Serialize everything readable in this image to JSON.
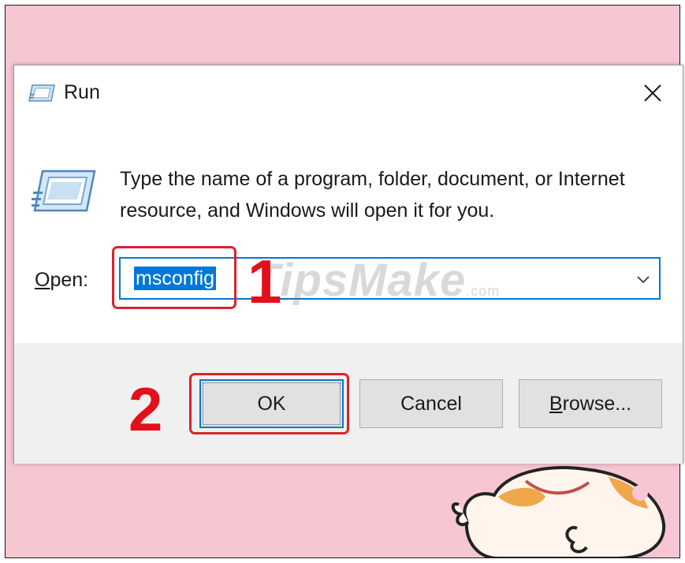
{
  "dialog": {
    "title": "Run",
    "description": "Type the name of a program, folder, document, or Internet resource, and Windows will open it for you.",
    "open_label_accel": "O",
    "open_label_rest": "pen:",
    "open_value": "msconfig",
    "buttons": {
      "ok": "OK",
      "cancel": "Cancel",
      "browse_accel": "B",
      "browse_rest": "rowse..."
    }
  },
  "annotations": {
    "step1": "1",
    "step2": "2",
    "watermark": "TipsMake",
    "watermark_suffix": ".com"
  },
  "icons": {
    "title_icon": "run-icon",
    "large_icon": "run-icon",
    "close": "close-icon",
    "dropdown": "chevron-down-icon"
  },
  "colors": {
    "accent": "#0078d7",
    "highlight_red": "#e3101c",
    "desktop_background": "#f7c6d3"
  }
}
